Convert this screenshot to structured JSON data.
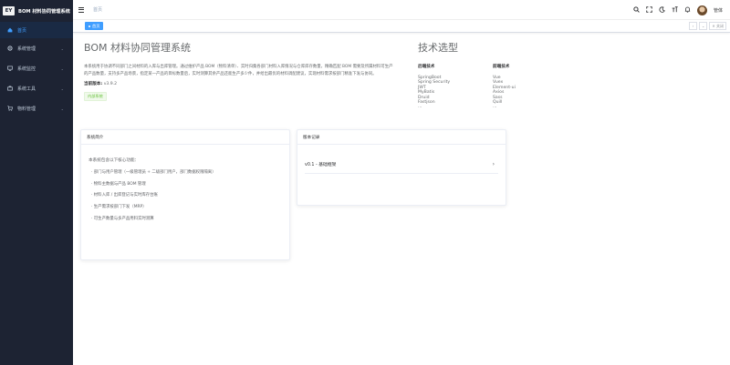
{
  "app": {
    "logo_text": "EY",
    "title": "BOM 材料协同管理系统"
  },
  "sidebar": {
    "items": [
      {
        "label": "首页",
        "icon": "home-icon",
        "active": true
      },
      {
        "label": "系统管理",
        "icon": "gear-icon"
      },
      {
        "label": "系统监控",
        "icon": "monitor-icon"
      },
      {
        "label": "系统工具",
        "icon": "toolbox-icon"
      },
      {
        "label": "物料管理",
        "icon": "cart-icon"
      }
    ]
  },
  "navbar": {
    "breadcrumb": "首页",
    "user_name": "管体"
  },
  "tags": {
    "active_tag": "首页",
    "close_label": "✕ 关闭"
  },
  "intro": {
    "title": "BOM 材料协同管理系统",
    "description": "本系统用于协调不同部门之间材料的入库与出库管理。通过维护产品 BOM（物料清单）、实时归集各部门材料入库情况与仓库库存数量，精确匹配 BOM 需要及所属材料可生产的产品数量，支持多产品场景，指定某一产品的目标数量后，实时测算其余产品还能生产多少件，并给出最优的材料调配建议，实现材料需求按部门精准下发与协同。",
    "version_label": "当前版本:",
    "version_value": "v3.9.2",
    "badge": "内部系统"
  },
  "tech": {
    "title": "技术选型",
    "backend_title": "后端技术",
    "backend": [
      "SpringBoot",
      "Spring Security",
      "JWT",
      "MyBatis",
      "Druid",
      "Fastjson",
      "..."
    ],
    "frontend_title": "前端技术",
    "frontend": [
      "Vue",
      "Vuex",
      "Element-ui",
      "Axios",
      "Sass",
      "Quill",
      "..."
    ]
  },
  "intro_card": {
    "header": "系统简介",
    "lead": "本系统包含以下核心功能：",
    "features": [
      "· 部门与用户管理（一级管理员 + 二级部门用户，部门数据权限隔离）",
      "· 物料主数据与产品 BOM 管理",
      "· 材料入库 / 出库登记与实时库存台账",
      "· 生产需求按部门下发（MRP）",
      "· 可生产数量与多产品用料实时测算"
    ]
  },
  "changelog_card": {
    "header": "版本记录",
    "entry": "v0.1 - 基础框架"
  }
}
